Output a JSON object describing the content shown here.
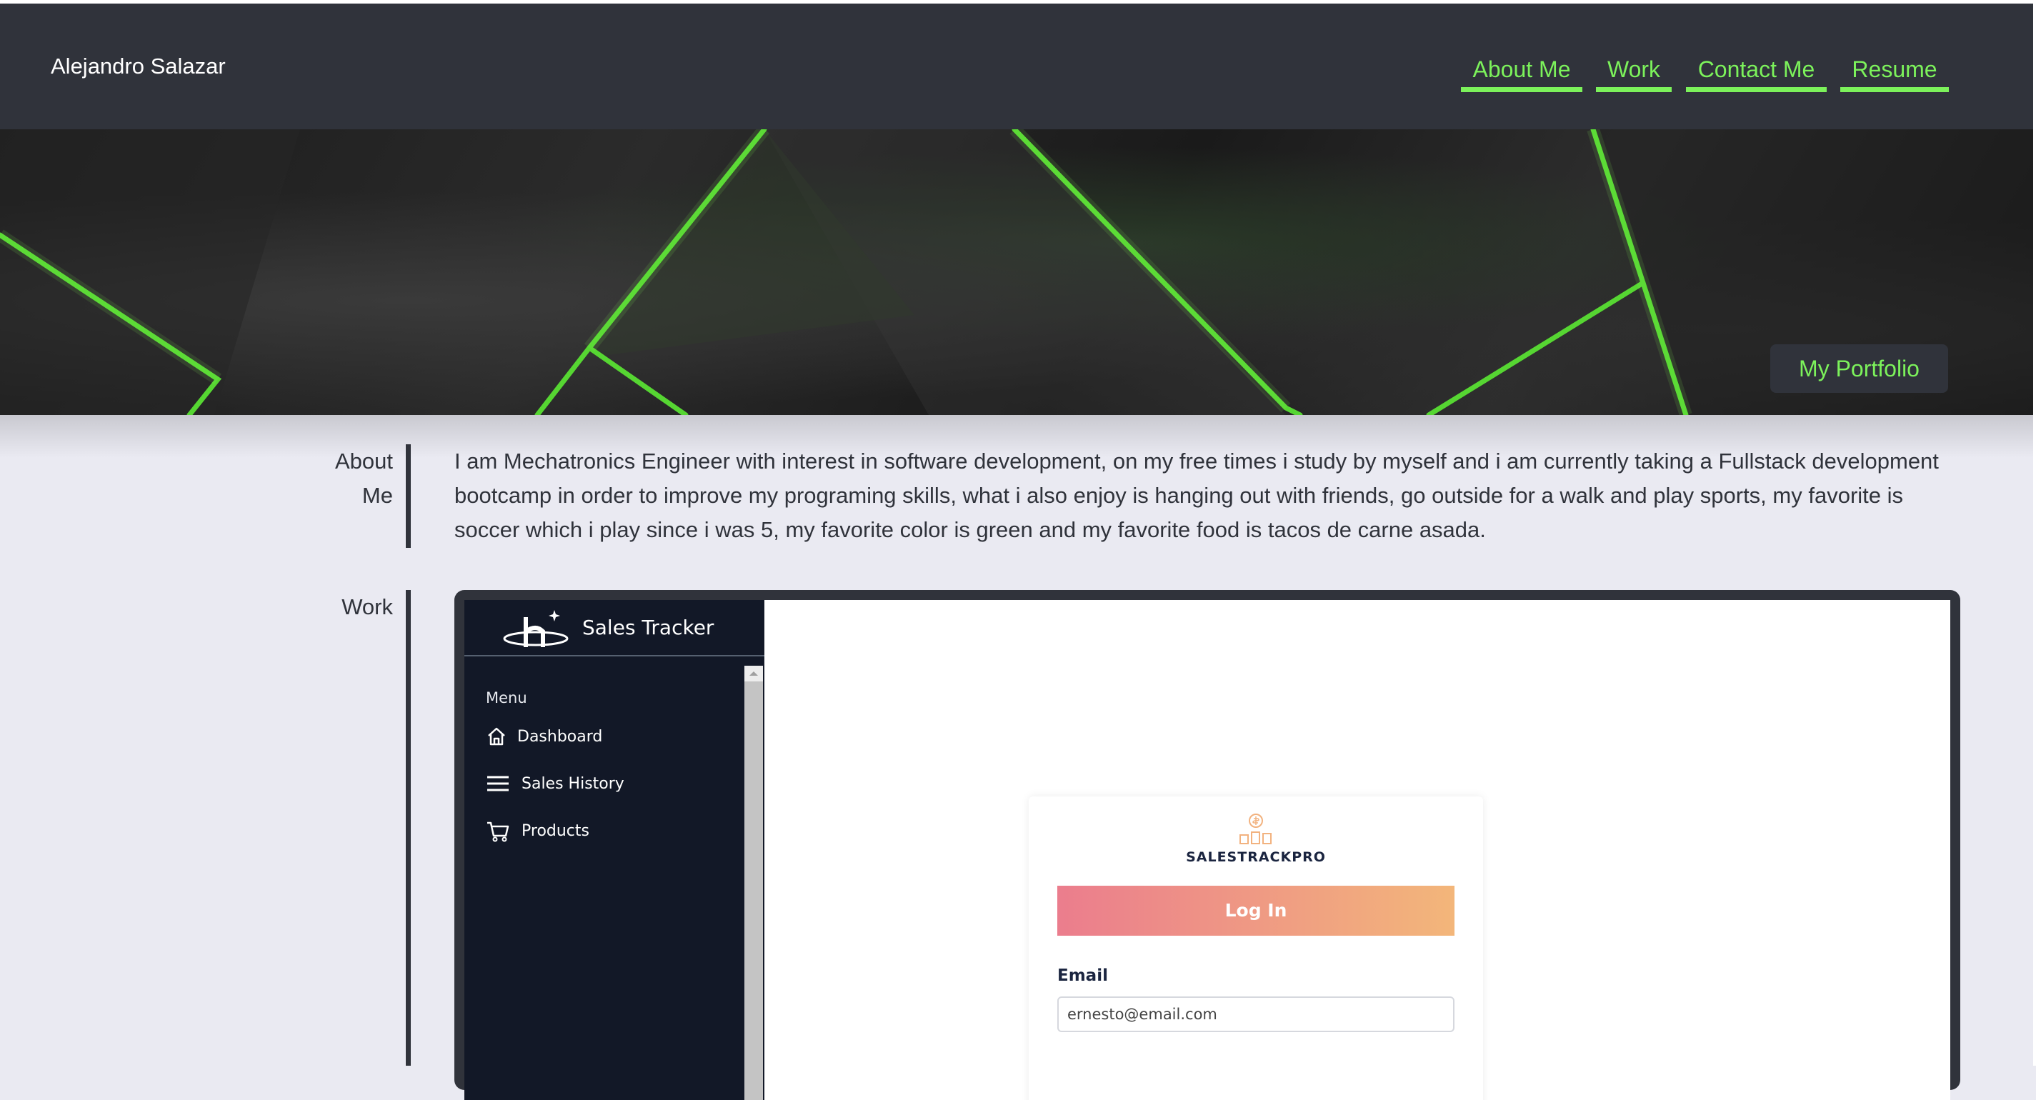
{
  "header": {
    "site_name": "Alejandro Salazar",
    "nav": [
      "About Me",
      "Work",
      "Contact Me",
      "Resume"
    ]
  },
  "hero": {
    "button_label": "My Portfolio"
  },
  "about": {
    "label_line1": "About",
    "label_line2": "Me",
    "text": "I am Mechatronics Engineer with interest in software development, on my free times i study by myself and i am currently taking a Fullstack development bootcamp in order to improve my programing skills, what i also enjoy is hanging out with friends, go outside for a walk and play sports, my favorite is soccer which i play since i was 5, my favorite color is green and my favorite food is tacos de carne asada."
  },
  "work": {
    "label": "Work",
    "app": {
      "title": "Sales Tracker",
      "menu_label": "Menu",
      "nav": [
        "Dashboard",
        "Sales History",
        "Products"
      ],
      "brand": "SALESTRACKPRO",
      "login_button": "Log In",
      "email_label": "Email",
      "email_value": "ernesto@email.com"
    }
  },
  "colors": {
    "accent": "#7cf25b",
    "header_bg": "#30333b",
    "page_bg": "#eaeaf2",
    "app_sidebar": "#121827"
  }
}
